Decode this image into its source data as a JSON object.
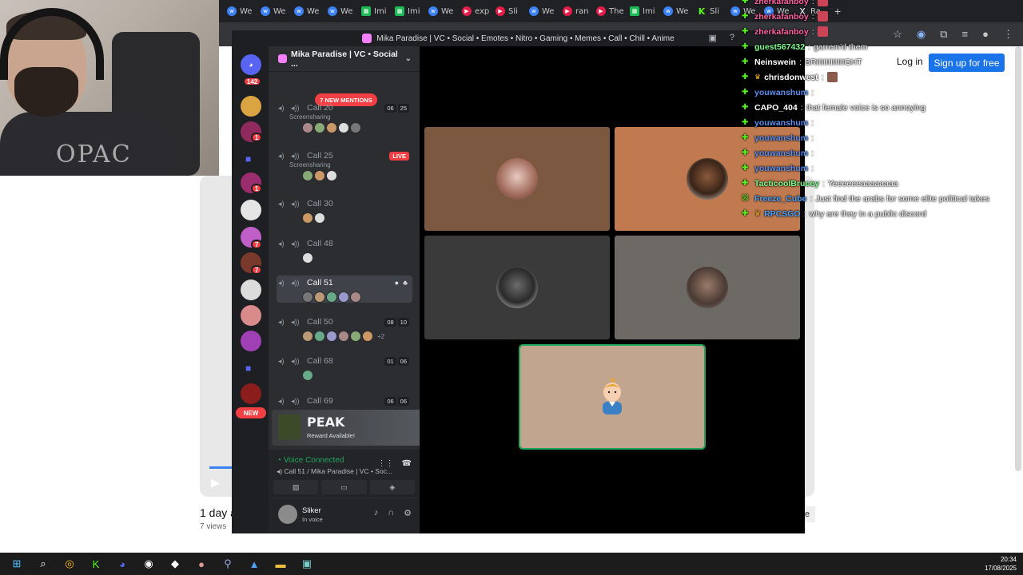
{
  "browser": {
    "tabs": [
      {
        "label": "We",
        "icon": "w",
        "kind": "blue"
      },
      {
        "label": "We",
        "icon": "w",
        "kind": "blue"
      },
      {
        "label": "We",
        "icon": "w",
        "kind": "blue"
      },
      {
        "label": "We",
        "icon": "w",
        "kind": "blue"
      },
      {
        "label": "Imi",
        "icon": "▦",
        "kind": "green"
      },
      {
        "label": "Imi",
        "icon": "▦",
        "kind": "green"
      },
      {
        "label": "We",
        "icon": "w",
        "kind": "blue"
      },
      {
        "label": "exp",
        "icon": "▶",
        "kind": "red"
      },
      {
        "label": "Sli",
        "icon": "▶",
        "kind": "red"
      },
      {
        "label": "We",
        "icon": "w",
        "kind": "blue"
      },
      {
        "label": "ran",
        "icon": "▶",
        "kind": "red"
      },
      {
        "label": "The",
        "icon": "▶",
        "kind": "red"
      },
      {
        "label": "Imi",
        "icon": "▦",
        "kind": "green"
      },
      {
        "label": "We",
        "icon": "w",
        "kind": "blue"
      },
      {
        "label": "Sli",
        "icon": "K",
        "kind": "kick"
      },
      {
        "label": "We",
        "icon": "w",
        "kind": "blue"
      },
      {
        "label": "We",
        "icon": "w",
        "kind": "blue"
      },
      {
        "label": "Ra",
        "icon": "X",
        "kind": "x"
      }
    ],
    "new_tab": "+",
    "login": "Log in",
    "signup": "Sign up for free"
  },
  "page": {
    "date": "1 day a",
    "views": "7 views",
    "side_btn": "e"
  },
  "discord": {
    "title": "Mika Paradise | VC • Social • Emotes • Nitro • Gaming • Memes • Call • Chill • Anime",
    "server_name": "Mika Paradise | VC • Social ...",
    "mentions_pill": "7 NEW MENTIONS",
    "new_pill": "NEW",
    "guild_badges": [
      "142",
      "1",
      "1",
      "7",
      "7"
    ],
    "channels": [
      {
        "name": "Call 20",
        "sub": "Screensharing",
        "counts": [
          "06",
          "25"
        ],
        "live": ""
      },
      {
        "name": "Call 25",
        "sub": "Screensharing",
        "counts": [],
        "live": "LIVE"
      },
      {
        "name": "Call 30",
        "sub": "",
        "counts": [],
        "live": ""
      },
      {
        "name": "Call 48",
        "sub": "",
        "counts": [],
        "live": ""
      },
      {
        "name": "Call 51",
        "sub": "",
        "counts": [],
        "live": ""
      },
      {
        "name": "Call 50",
        "sub": "",
        "counts": [
          "08",
          "10"
        ],
        "live": "",
        "more": "+2"
      },
      {
        "name": "Call 68",
        "sub": "",
        "counts": [
          "01",
          "06"
        ],
        "live": ""
      },
      {
        "name": "Call 69",
        "sub": "",
        "counts": [
          "06",
          "06"
        ],
        "live": ""
      }
    ],
    "promo": {
      "title": "PEAK",
      "sub": "Reward Available!"
    },
    "voice": {
      "status": "Voice Connected",
      "channel": "Call 51 / Mika Paradise | VC • Soc..."
    },
    "user": {
      "name": "Sliker",
      "status": "In voice"
    }
  },
  "chat": [
    {
      "user": "zherkafanboy",
      "text": "",
      "color": "#ff5fa2",
      "badge": "✚",
      "emote": true
    },
    {
      "user": "zherkafanboy",
      "text": "",
      "color": "#ff5fa2",
      "badge": "✚",
      "emote": true
    },
    {
      "user": "zherkafanboy",
      "text": "",
      "color": "#ff5fa2",
      "badge": "✚",
      "emote": true
    },
    {
      "user": "guest567432",
      "text": "garrem'd them",
      "color": "#7cfc8a",
      "badge": "✚",
      "emote": false
    },
    {
      "user": "Neinswein",
      "text": "BRIIIIIIIIIIIIGHT",
      "color": "#ffffff",
      "badge": "✚",
      "emote": false
    },
    {
      "user": "chrisdonwest",
      "text": "",
      "color": "#ffffff",
      "badge": "✚",
      "crown": "♛",
      "emote": true
    },
    {
      "user": "youwanshum",
      "text": "",
      "color": "#5b8def",
      "badge": "✚",
      "emote": false
    },
    {
      "user": "CAPO_404",
      "text": "that female voice is so annoying",
      "color": "#ffffff",
      "badge": "✚",
      "emote": false
    },
    {
      "user": "youwanshum",
      "text": "",
      "color": "#5b8def",
      "badge": "✚",
      "emote": false
    },
    {
      "user": "youwanshum",
      "text": "",
      "color": "#5b8def",
      "badge": "✚",
      "emote": false
    },
    {
      "user": "youwanshum",
      "text": "",
      "color": "#5b8def",
      "badge": "✚",
      "emote": false
    },
    {
      "user": "youwanshum",
      "text": "",
      "color": "#5b8def",
      "badge": "✚",
      "emote": false
    },
    {
      "user": "TacticoolBrucey",
      "text": "Yeeeeeeaaaaaaaa",
      "color": "#7cfc8a",
      "badge": "✚",
      "emote": false
    },
    {
      "user": "Freeze_Cube",
      "text": "Just find the arabs for some elite political takes",
      "color": "#4aa3ff",
      "badge": "☒",
      "emote": false
    },
    {
      "user": "RPCSGO",
      "text": "why are they in a public discord",
      "color": "#4aa3ff",
      "badge": "✚",
      "crown": "♛",
      "emote": false
    }
  ],
  "taskbar": {
    "time": "20:34",
    "date": "17/08/2025"
  },
  "colors": {
    "discord_bg": "#2b2d31",
    "discord_dark": "#1e1f22",
    "mention_red": "#f23f43",
    "voice_green": "#23a55a",
    "signup_blue": "#1a73e8"
  }
}
